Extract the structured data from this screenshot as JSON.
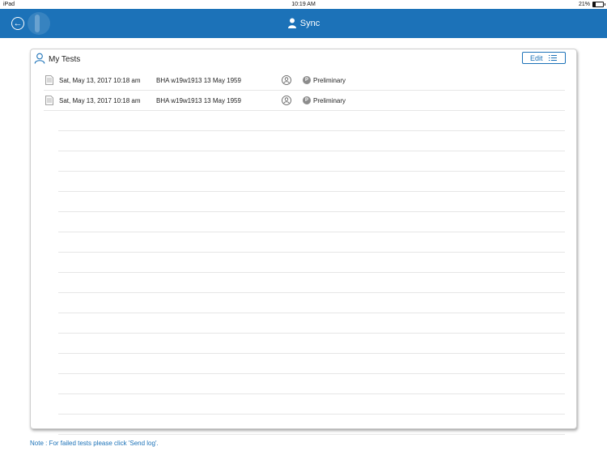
{
  "status_bar": {
    "carrier": "iPad",
    "time": "10:19 AM",
    "battery": "21%",
    "battery_level": 0.21
  },
  "nav": {
    "title": "Sync",
    "back_icon": "back-arrow-circle-icon",
    "title_icon": "user-sync-icon"
  },
  "card": {
    "title": "My Tests",
    "edit_label": "Edit",
    "rows": [
      {
        "date": "Sat, May 13, 2017 10:18 am",
        "patient": "BHA w19w1913 13 May 1959",
        "badge": "P",
        "status": "Preliminary"
      },
      {
        "date": "Sat, May 13, 2017 10:18 am",
        "patient": "BHA w19w1913 13 May 1959",
        "badge": "P",
        "status": "Preliminary"
      }
    ]
  },
  "note": "Note : For failed tests please click 'Send log'.",
  "colors": {
    "accent": "#1c72b8",
    "badge": "#8c8c8c"
  }
}
